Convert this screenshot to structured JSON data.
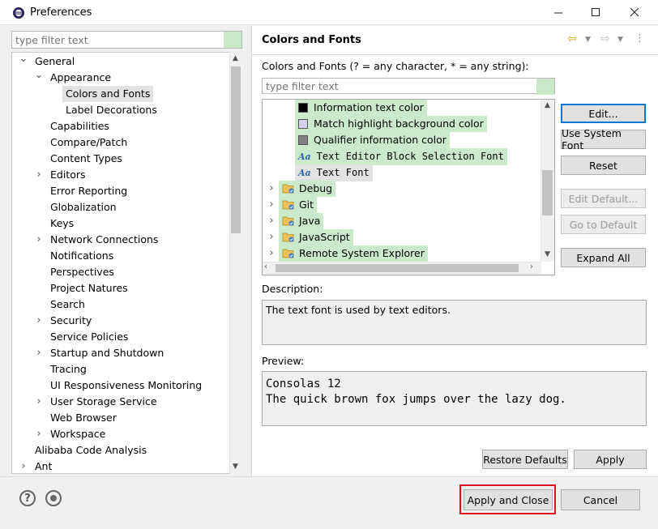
{
  "window": {
    "title": "Preferences"
  },
  "left": {
    "filter_placeholder": "type filter text",
    "tree": [
      {
        "label": "General",
        "indent": 0,
        "twisty": "open"
      },
      {
        "label": "Appearance",
        "indent": 1,
        "twisty": "open"
      },
      {
        "label": "Colors and Fonts",
        "indent": 2,
        "twisty": "none",
        "selected": true
      },
      {
        "label": "Label Decorations",
        "indent": 2,
        "twisty": "none"
      },
      {
        "label": "Capabilities",
        "indent": 1,
        "twisty": "none"
      },
      {
        "label": "Compare/Patch",
        "indent": 1,
        "twisty": "none"
      },
      {
        "label": "Content Types",
        "indent": 1,
        "twisty": "none"
      },
      {
        "label": "Editors",
        "indent": 1,
        "twisty": "closed"
      },
      {
        "label": "Error Reporting",
        "indent": 1,
        "twisty": "none"
      },
      {
        "label": "Globalization",
        "indent": 1,
        "twisty": "none"
      },
      {
        "label": "Keys",
        "indent": 1,
        "twisty": "none"
      },
      {
        "label": "Network Connections",
        "indent": 1,
        "twisty": "closed"
      },
      {
        "label": "Notifications",
        "indent": 1,
        "twisty": "none"
      },
      {
        "label": "Perspectives",
        "indent": 1,
        "twisty": "none"
      },
      {
        "label": "Project Natures",
        "indent": 1,
        "twisty": "none"
      },
      {
        "label": "Search",
        "indent": 1,
        "twisty": "none"
      },
      {
        "label": "Security",
        "indent": 1,
        "twisty": "closed"
      },
      {
        "label": "Service Policies",
        "indent": 1,
        "twisty": "none"
      },
      {
        "label": "Startup and Shutdown",
        "indent": 1,
        "twisty": "closed"
      },
      {
        "label": "Tracing",
        "indent": 1,
        "twisty": "none"
      },
      {
        "label": "UI Responsiveness Monitoring",
        "indent": 1,
        "twisty": "none"
      },
      {
        "label": "User Storage Service",
        "indent": 1,
        "twisty": "closed"
      },
      {
        "label": "Web Browser",
        "indent": 1,
        "twisty": "none"
      },
      {
        "label": "Workspace",
        "indent": 1,
        "twisty": "closed"
      },
      {
        "label": "Alibaba Code Analysis",
        "indent": 0,
        "twisty": "none"
      },
      {
        "label": "Ant",
        "indent": 0,
        "twisty": "closed"
      }
    ]
  },
  "right": {
    "title": "Colors and Fonts",
    "section_label": "Colors and Fonts (? = any character, * = any string):",
    "filter_placeholder": "type filter text",
    "tree": [
      {
        "label": "Information text color",
        "kind": "swatch",
        "color": "#000000",
        "highlight": true
      },
      {
        "label": "Match highlight background color",
        "kind": "swatch",
        "color": "#d3d1f0",
        "highlight": true
      },
      {
        "label": "Qualifier information color",
        "kind": "swatch",
        "color": "#808080",
        "highlight": true
      },
      {
        "label": "Text Editor Block Selection Font",
        "kind": "font",
        "highlight": true
      },
      {
        "label": "Text Font",
        "kind": "font",
        "selected": true
      },
      {
        "label": "Debug",
        "kind": "folder",
        "highlight": true
      },
      {
        "label": "Git",
        "kind": "folder",
        "highlight": true
      },
      {
        "label": "Java",
        "kind": "folder",
        "highlight": true
      },
      {
        "label": "JavaScript",
        "kind": "folder",
        "highlight": true
      },
      {
        "label": "Remote System Explorer",
        "kind": "folder",
        "highlight": true
      }
    ],
    "buttons": {
      "edit": "Edit...",
      "use_system_font": "Use System Font",
      "reset": "Reset",
      "edit_default": "Edit Default...",
      "go_to_default": "Go to Default",
      "expand_all": "Expand All"
    },
    "description_label": "Description:",
    "description_text": "The text font is used by text editors.",
    "preview_label": "Preview:",
    "preview_text": "Consolas 12\nThe quick brown fox jumps over the lazy dog.",
    "restore_defaults": "Restore Defaults",
    "apply": "Apply"
  },
  "bottom": {
    "apply_and_close": "Apply and Close",
    "cancel": "Cancel"
  },
  "colors": {
    "filter_highlight": "#cbe9cb",
    "callout": "#e0141e",
    "focus": "#0078d7"
  }
}
